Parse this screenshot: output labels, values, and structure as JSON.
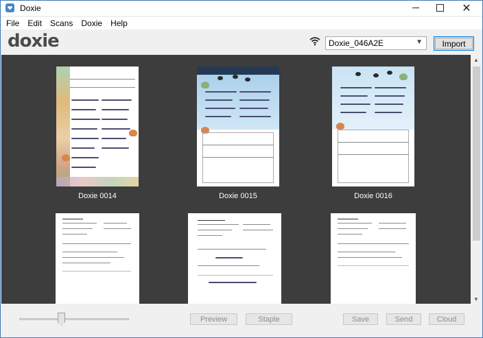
{
  "window": {
    "title": "Doxie"
  },
  "menu": {
    "items": [
      "File",
      "Edit",
      "Scans",
      "Doxie",
      "Help"
    ]
  },
  "toolbar": {
    "logo_text": "doxie",
    "device_selected": "Doxie_046A2E",
    "import_label": "Import"
  },
  "scans": [
    {
      "label": "Doxie 0014"
    },
    {
      "label": "Doxie 0015"
    },
    {
      "label": "Doxie 0016"
    }
  ],
  "bottom": {
    "preview_label": "Preview",
    "staple_label": "Staple",
    "save_label": "Save",
    "send_label": "Send",
    "cloud_label": "Cloud"
  },
  "colors": {
    "scan_area_bg": "#3d3d3d",
    "window_border": "#3f78b4",
    "accent": "#0078d7"
  },
  "icons": {
    "app": "doxie-heart-icon",
    "wifi": "wifi-icon",
    "minimize": "minimize-icon",
    "maximize": "maximize-icon",
    "close": "close-icon",
    "dropdown": "chevron-down-icon"
  }
}
